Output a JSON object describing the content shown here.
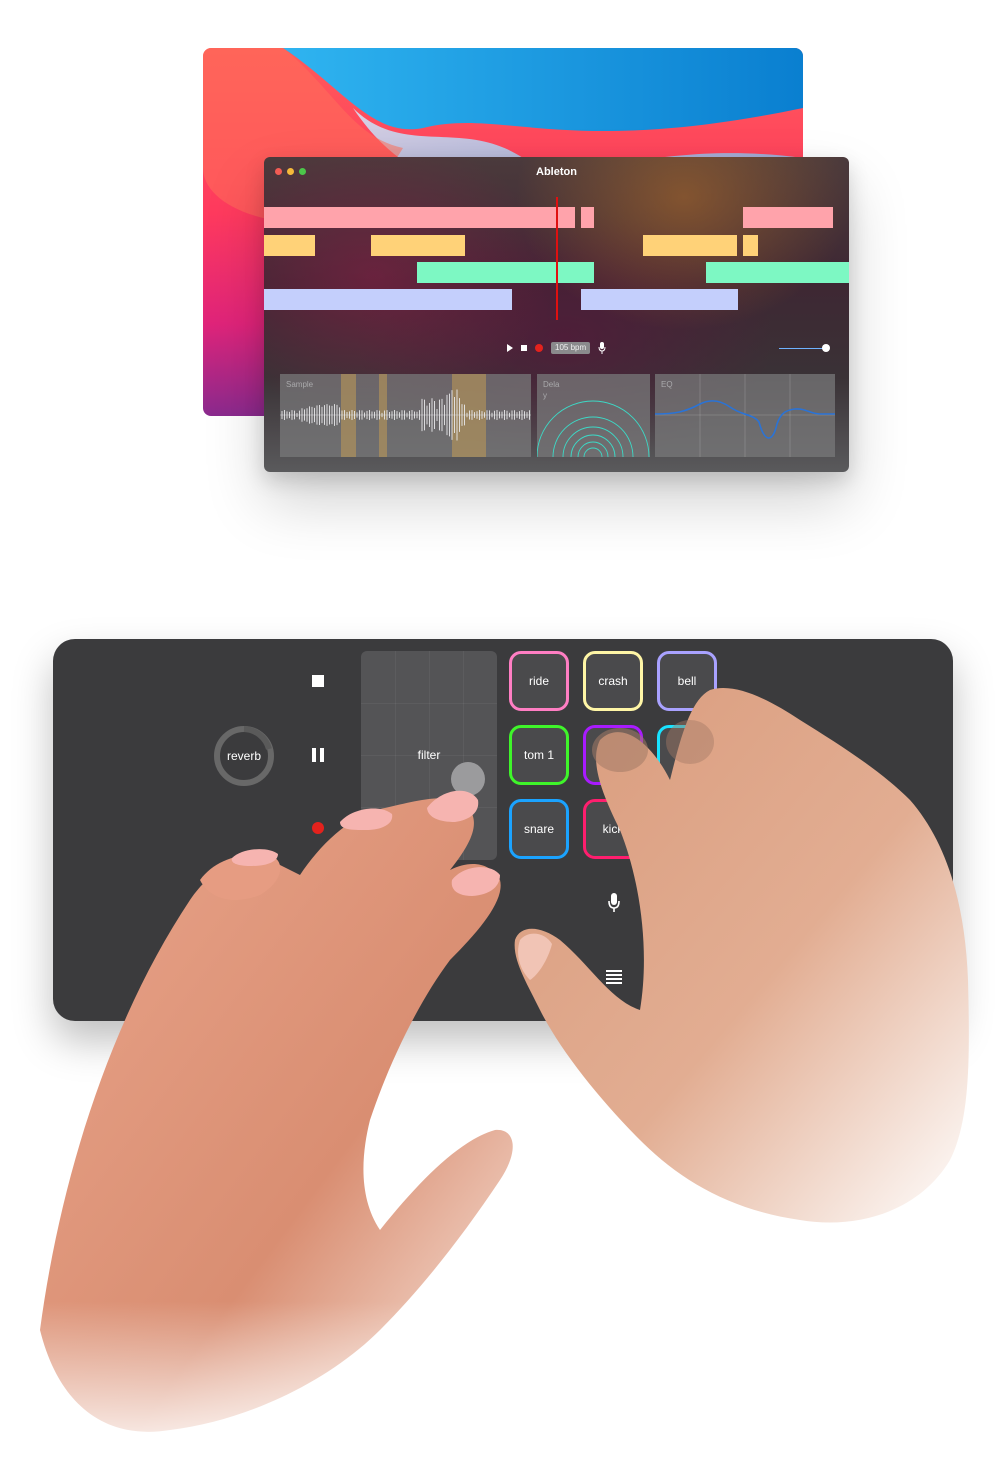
{
  "daw": {
    "title": "Ableton",
    "bpm": "105 bpm",
    "panels": {
      "sample": "Sample",
      "delay": "Dela y",
      "eq": "EQ"
    }
  },
  "controller": {
    "knob_label": "reverb",
    "filter_label": "filter",
    "pads": [
      {
        "label": "ride",
        "color": "#ff7ec3"
      },
      {
        "label": "crash",
        "color": "#fff6a6"
      },
      {
        "label": "bell",
        "color": "#a9a2ff"
      },
      {
        "label": "tom 1",
        "color": "#3ff52a"
      },
      {
        "label": "",
        "color": "#a91bff"
      },
      {
        "label": "",
        "color": "#18e2ff"
      },
      {
        "label": "snare",
        "color": "#1ba3ff"
      },
      {
        "label": "kick",
        "color": "#ff1e6e"
      },
      {
        "label": "",
        "color": "#ffb400"
      }
    ],
    "icons": [
      "stop-icon",
      "pause-icon",
      "record-icon",
      "microphone-icon",
      "menu-icon",
      "loop-icon"
    ]
  },
  "colors": {
    "clip_pink": "#ffa3ab",
    "clip_yellow": "#ffd278",
    "clip_mint": "#7df8c3",
    "clip_lavender": "#c4cffc",
    "playhead": "#e01010"
  }
}
